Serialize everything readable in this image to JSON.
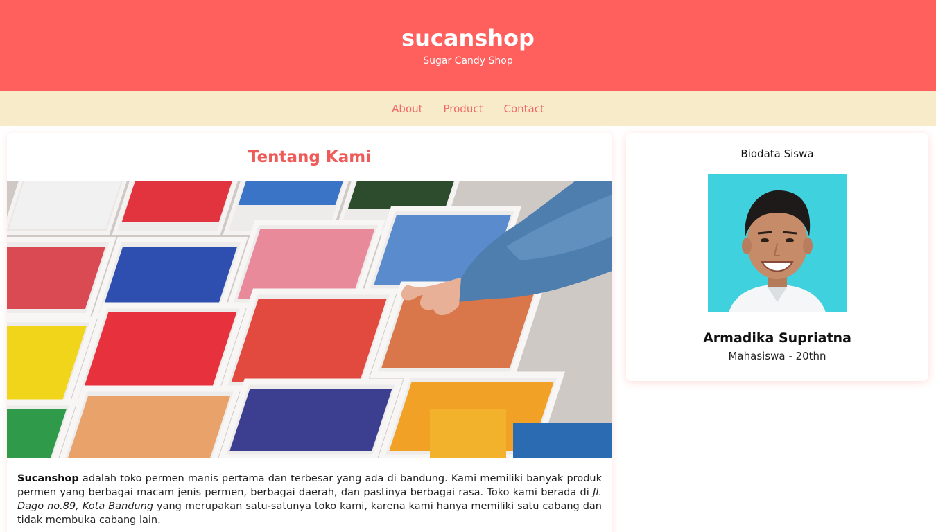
{
  "header": {
    "title": "sucanshop",
    "subtitle": "Sugar Candy Shop"
  },
  "nav": {
    "items": [
      "About",
      "Product",
      "Contact"
    ]
  },
  "about": {
    "heading": "Tentang Kami",
    "text": {
      "brand": "Sucanshop",
      "part1": " adalah toko permen manis pertama dan terbesar yang ada di bandung. Kami memiliki banyak produk permen yang berbagai macam jenis permen, berbagai daerah, dan pastinya berbagai rasa. Toko kami berada di ",
      "address": "Jl. Dago no.89, Kota Bandung",
      "part2": " yang merupakan satu-satunya toko kami, karena kami hanya memiliki satu cabang dan tidak membuka cabang lain."
    }
  },
  "profile": {
    "title": "Biodata Siswa",
    "name": "Armadika Supriatna",
    "role": "Mahasiswa - 20thn"
  },
  "colors": {
    "header_bg": "#ff5f5d",
    "nav_bg": "#f8ebc9",
    "accent": "#ef5b58"
  }
}
